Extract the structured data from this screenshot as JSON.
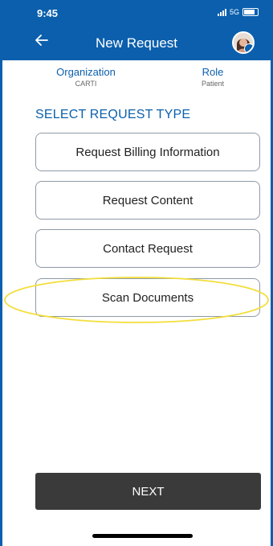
{
  "status_bar": {
    "time": "9:45",
    "network": "5G"
  },
  "header": {
    "title": "New Request"
  },
  "info": {
    "organization_label": "Organization",
    "organization_value": "CARTI",
    "role_label": "Role",
    "role_value": "Patient"
  },
  "section_title": "SELECT REQUEST TYPE",
  "request_types": [
    {
      "label": "Request Billing Information"
    },
    {
      "label": "Request Content"
    },
    {
      "label": "Contact Request"
    },
    {
      "label": "Scan Documents"
    }
  ],
  "next_label": "NEXT",
  "colors": {
    "primary": "#0b5fad",
    "button_dark": "#3a3a3a",
    "highlight": "#f3de3a"
  },
  "icons": {
    "back": "arrow-left-icon",
    "avatar": "user-avatar-icon",
    "signal": "signal-icon",
    "battery": "battery-icon"
  }
}
